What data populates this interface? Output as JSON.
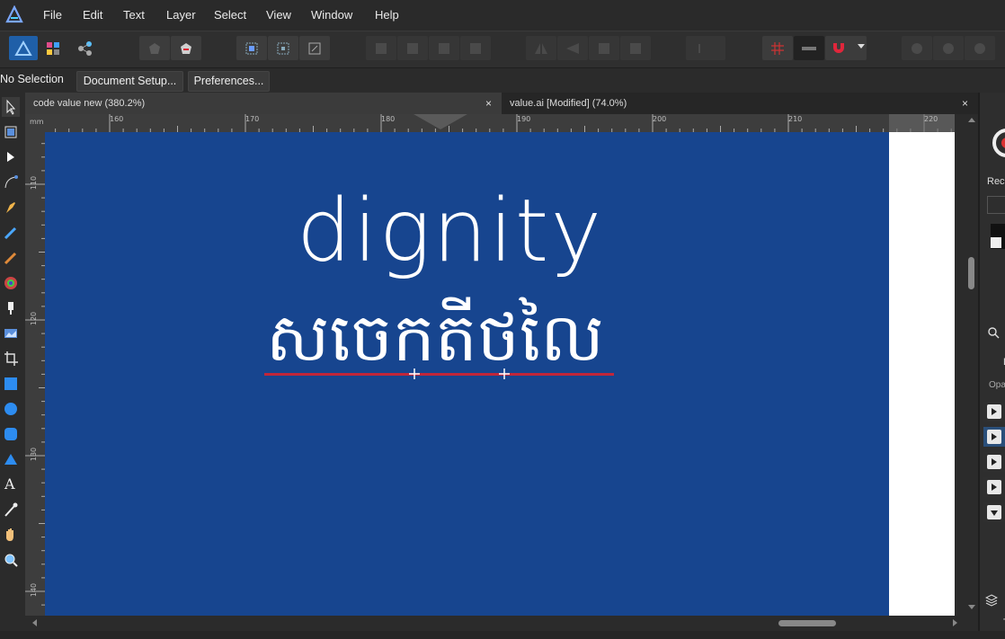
{
  "menubar": {
    "items": [
      "File",
      "Edit",
      "Text",
      "Layer",
      "Select",
      "View",
      "Window",
      "Help"
    ]
  },
  "context_bar": {
    "selection_label": "No Selection",
    "document_setup_label": "Document Setup...",
    "preferences_label": "Preferences..."
  },
  "tabs": [
    {
      "label": "code value new (380.2%)",
      "close": "×"
    },
    {
      "label": "value.ai [Modified] (74.0%)",
      "close": "×"
    }
  ],
  "ruler": {
    "top": [
      "160",
      "170",
      "180",
      "190",
      "200",
      "210",
      "220"
    ],
    "left": [
      "110",
      "120",
      "130",
      "140"
    ],
    "unit": "mm"
  },
  "canvas": {
    "english_word": "dignity",
    "khmer_word": "សចេកតីថលៃ",
    "artboard_color": "#17458f",
    "text_color": "#ffffff",
    "underline_color": "#c1263a"
  },
  "right_panel": {
    "recent_label": "Rece",
    "opacity_label": "Opa",
    "layer_label": "L",
    "t_label": "T"
  },
  "colors": {
    "accent": "#1aa3ff",
    "background": "#2b2b2b"
  }
}
